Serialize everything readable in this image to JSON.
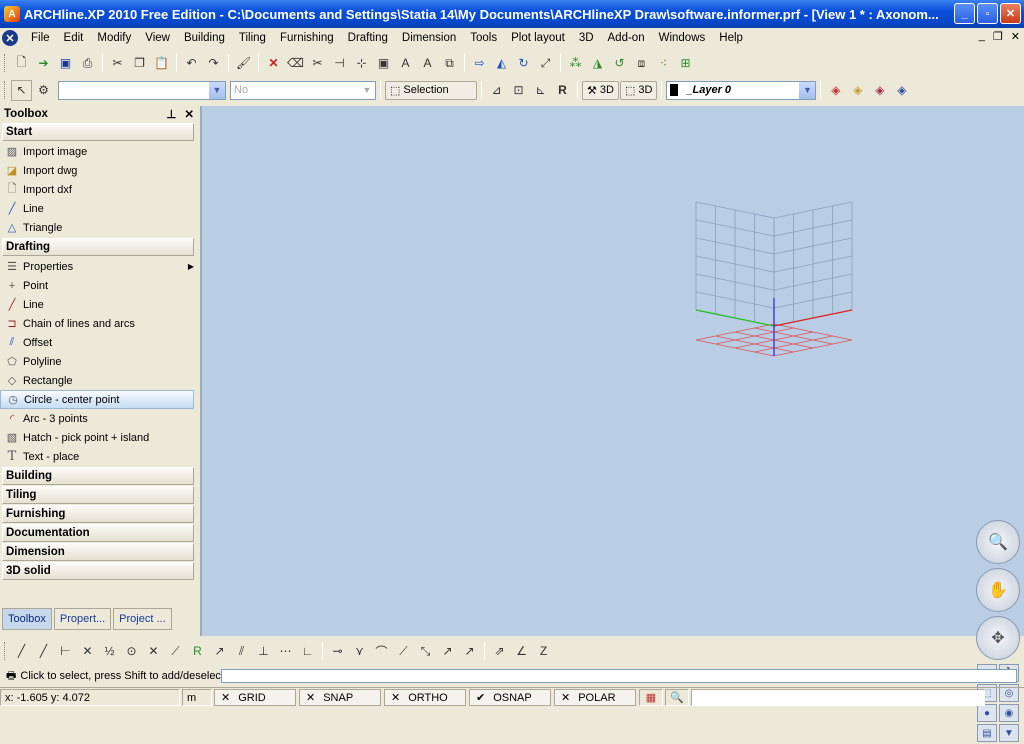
{
  "titlebar": {
    "title": "ARCHline.XP 2010 Free Edition - C:\\Documents and Settings\\Statia 14\\My Documents\\ARCHlineXP Draw\\software.informer.prf - [View 1 * : Axonom..."
  },
  "menu": [
    "File",
    "Edit",
    "Modify",
    "View",
    "Building",
    "Tiling",
    "Furnishing",
    "Drafting",
    "Dimension",
    "Tools",
    "Plot layout",
    "3D",
    "Add-on",
    "Windows",
    "Help"
  ],
  "toolbar2": {
    "combo_no": "No",
    "selection_label": "Selection",
    "btn_3d_a": "3D",
    "btn_3d_b": "3D",
    "layer": "_Layer 0"
  },
  "toolbox": {
    "title": "Toolbox",
    "sections": {
      "start": "Start",
      "drafting": "Drafting",
      "building": "Building",
      "tiling": "Tiling",
      "furnishing": "Furnishing",
      "documentation": "Documentation",
      "dimension": "Dimension",
      "solid3d": "3D solid"
    },
    "start_items": [
      "Import image",
      "Import dwg",
      "Import dxf",
      "Line",
      "Triangle"
    ],
    "drafting_items": [
      "Properties",
      "Point",
      "Line",
      "Chain of lines and arcs",
      "Offset",
      "Polyline",
      "Rectangle",
      "Circle - center point",
      "Arc - 3 points",
      "Hatch - pick point + island",
      "Text - place"
    ],
    "tabs": [
      "Toolbox",
      "Propert...",
      "Project ..."
    ]
  },
  "command": {
    "prompt": "Click to select, press Shift to add/deselect"
  },
  "status": {
    "coords": "x: -1.605  y: 4.072",
    "unit": "m",
    "modes": [
      {
        "label": "GRID",
        "mark": "✕"
      },
      {
        "label": "SNAP",
        "mark": "✕"
      },
      {
        "label": "ORTHO",
        "mark": "✕"
      },
      {
        "label": "OSNAP",
        "mark": "✔"
      },
      {
        "label": "POLAR",
        "mark": "✕"
      }
    ]
  },
  "colors": {
    "viewport_bg": "#b9cde5",
    "x_axis": "#e02020",
    "y_axis": "#20c020",
    "z_axis": "#2020e0",
    "grid": "#8aa0bc",
    "floor_grid": "#e05050"
  }
}
